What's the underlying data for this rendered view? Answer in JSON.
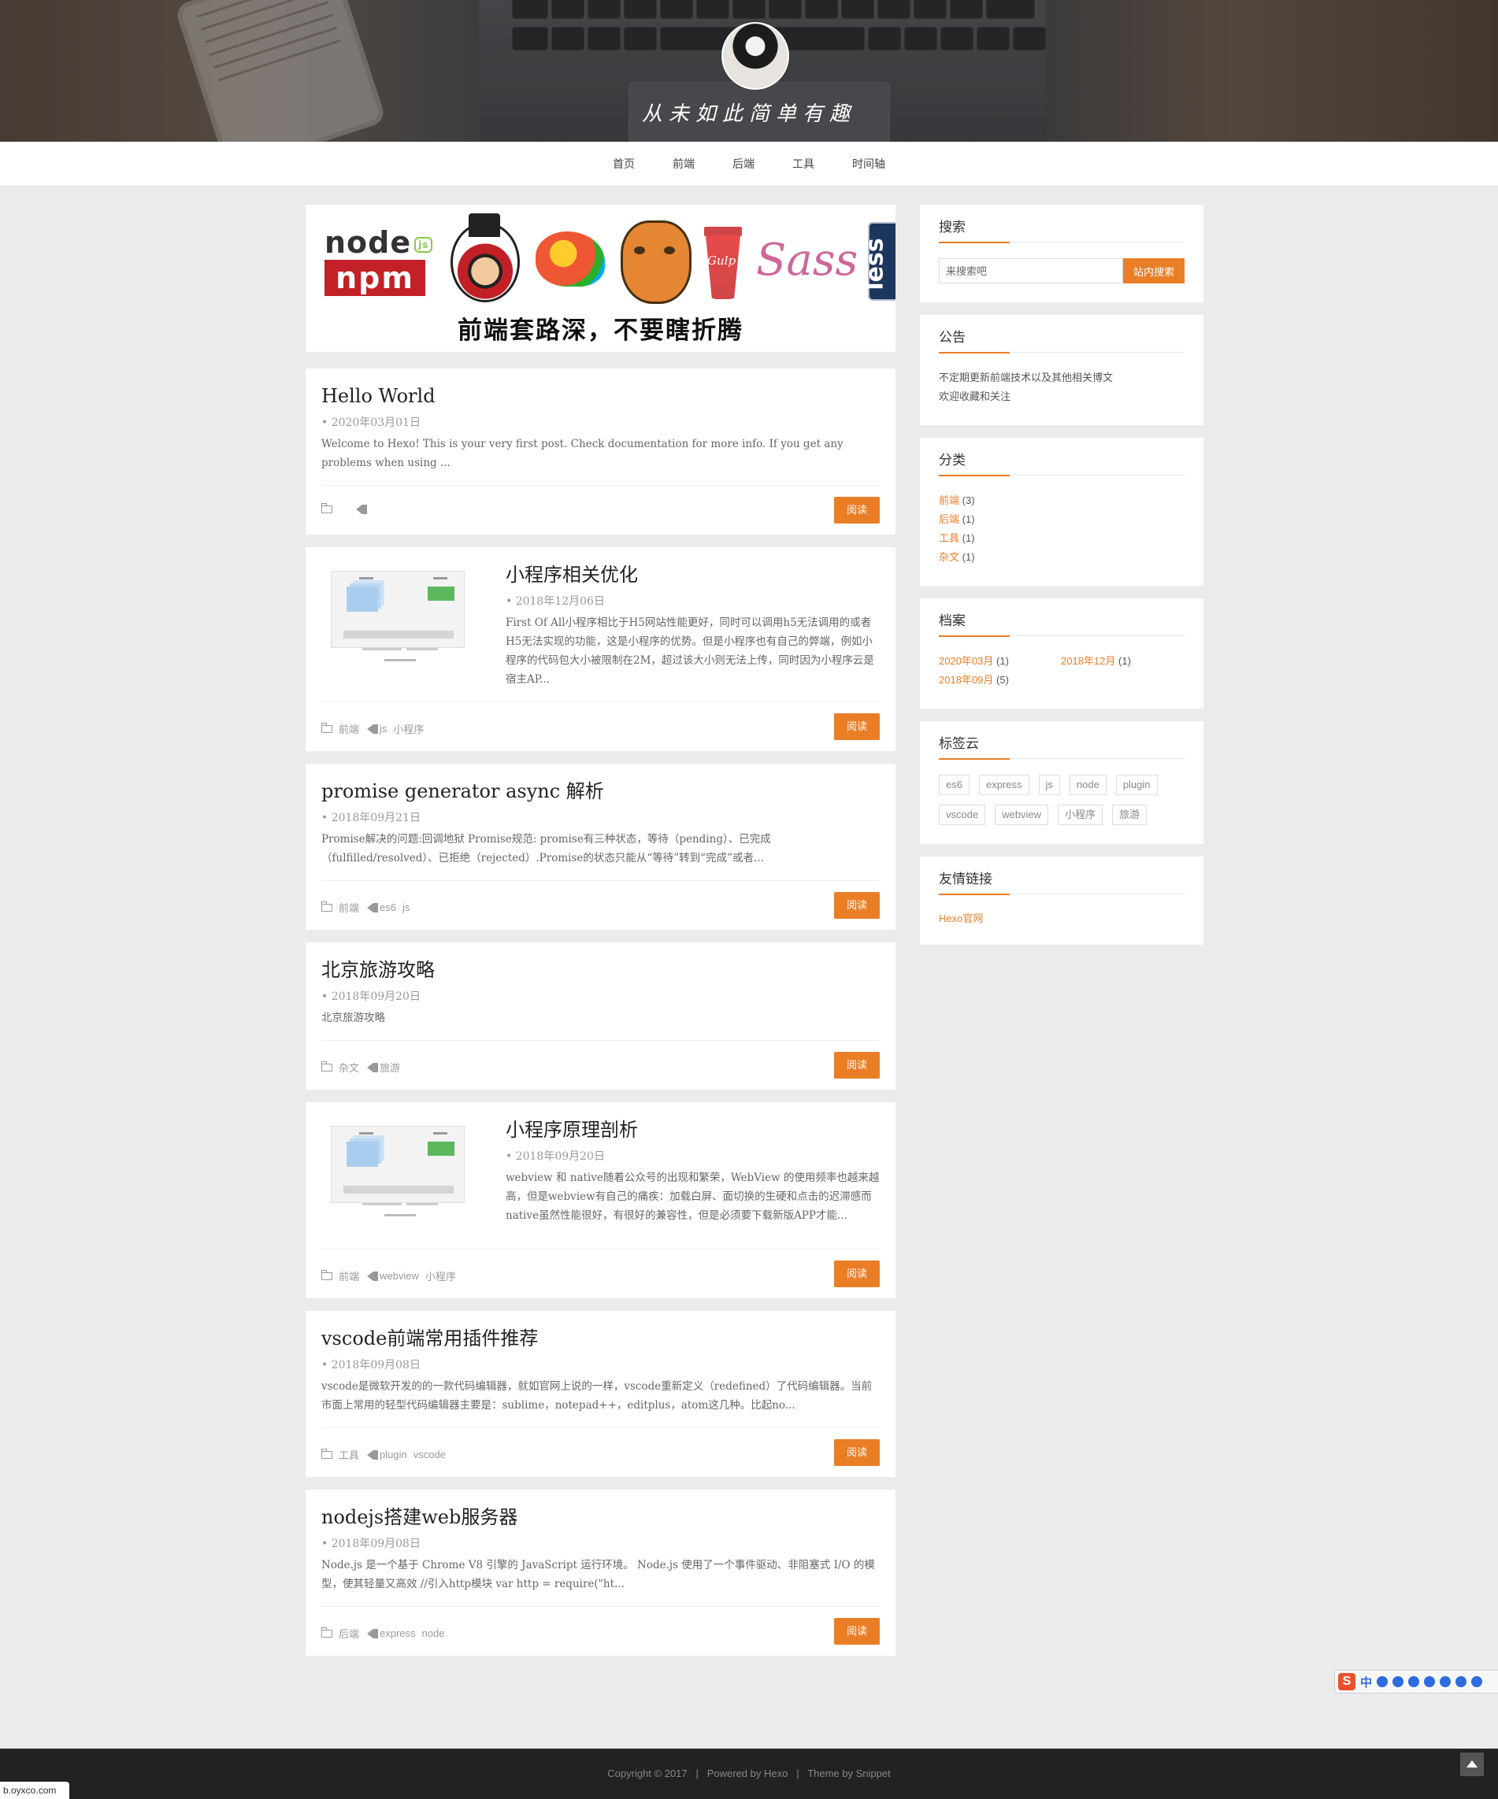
{
  "header": {
    "slogan": "从未如此简单有趣"
  },
  "nav": {
    "items": [
      "首页",
      "前端",
      "后端",
      "工具",
      "时间轴"
    ]
  },
  "banner": {
    "logo_texts": {
      "node": "node",
      "js": "js",
      "npm": "npm",
      "gulp": "Gulp",
      "sass": "Sass",
      "less": "less"
    },
    "caption": "前端套路深，不要瞎折腾"
  },
  "posts": [
    {
      "title": "Hello World",
      "date": "• 2020年03月01日",
      "excerpt": "Welcome to Hexo! This is your very first post. Check documentation for more info. If you get any problems when using ...",
      "category": "",
      "tags": [],
      "read_label": "阅读",
      "has_thumb": false
    },
    {
      "title": "小程序相关优化",
      "date": "• 2018年12月06日",
      "excerpt": "First Of All小程序相比于H5网站性能更好，同时可以调用h5无法调用的或者H5无法实现的功能，这是小程序的优势。但是小程序也有自己的弊端，例如小程序的代码包大小被限制在2M，超过该大小则无法上传，同时因为小程序云是宿主AP...",
      "category": "前端",
      "tags": [
        "js",
        "小程序"
      ],
      "read_label": "阅读",
      "has_thumb": true
    },
    {
      "title": "promise generator async 解析",
      "date": "• 2018年09月21日",
      "excerpt": "Promise解决的问题:回调地狱 Promise规范: promise有三种状态，等待（pending）、已完成（fulfilled/resolved）、已拒绝（rejected）.Promise的状态只能从“等待”转到“完成”或者...",
      "category": "前端",
      "tags": [
        "es6",
        "js"
      ],
      "read_label": "阅读",
      "has_thumb": false
    },
    {
      "title": "北京旅游攻略",
      "date": "• 2018年09月20日",
      "excerpt": "北京旅游攻略",
      "category": "杂文",
      "tags": [
        "旅游"
      ],
      "read_label": "阅读",
      "has_thumb": false
    },
    {
      "title": "小程序原理剖析",
      "date": "• 2018年09月20日",
      "excerpt": "webview 和 native随着公众号的出现和繁荣，WebView 的使用频率也越来越高，但是webview有自己的痛疾：加载白屏、面切换的生硬和点击的迟滞感而native虽然性能很好，有很好的兼容性，但是必须要下载新版APP才能...",
      "category": "前端",
      "tags": [
        "webview",
        "小程序"
      ],
      "read_label": "阅读",
      "has_thumb": true
    },
    {
      "title": "vscode前端常用插件推荐",
      "date": "• 2018年09月08日",
      "excerpt": "vscode是微软开发的的一款代码编辑器，就如官网上说的一样，vscode重新定义（redefined）了代码编辑器。当前市面上常用的轻型代码编辑器主要是：sublime，notepad++，editplus，atom这几种。比起no...",
      "category": "工具",
      "tags": [
        "plugin",
        "vscode"
      ],
      "read_label": "阅读",
      "has_thumb": false
    },
    {
      "title": "nodejs搭建web服务器",
      "date": "• 2018年09月08日",
      "excerpt": "Node.js 是一个基于 Chrome V8 引擎的 JavaScript 运行环境。 Node.js 使用了一个事件驱动、非阻塞式 I/O 的模型，使其轻量又高效 //引入http模块 var http = require(\"ht...",
      "category": "后端",
      "tags": [
        "express",
        "node"
      ],
      "read_label": "阅读",
      "has_thumb": false
    }
  ],
  "sidebar": {
    "search": {
      "title": "搜索",
      "placeholder": "来搜索吧",
      "button": "站内搜索"
    },
    "notice": {
      "title": "公告",
      "lines": [
        "不定期更新前端技术以及其他相关博文",
        "欢迎收藏和关注"
      ]
    },
    "categories": {
      "title": "分类",
      "items": [
        {
          "name": "前端",
          "count": "(3)"
        },
        {
          "name": "后端",
          "count": "(1)"
        },
        {
          "name": "工具",
          "count": "(1)"
        },
        {
          "name": "杂文",
          "count": "(1)"
        }
      ]
    },
    "archive": {
      "title": "档案",
      "items": [
        {
          "name": "2020年03月",
          "count": "(1)"
        },
        {
          "name": "2018年12月",
          "count": "(1)"
        },
        {
          "name": "2018年09月",
          "count": "(5)"
        }
      ]
    },
    "tagcloud": {
      "title": "标签云",
      "tags": [
        "es6",
        "express",
        "js",
        "node",
        "plugin",
        "vscode",
        "webview",
        "小程序",
        "旅游"
      ]
    },
    "links": {
      "title": "友情链接",
      "items": [
        "Hexo官网"
      ]
    }
  },
  "footer": {
    "copyright": "Copyright © 2017",
    "sep": "|",
    "powered": "Powered by Hexo",
    "theme": "Theme by Snippet"
  },
  "statusbar": {
    "url": "b.oyxco.com"
  },
  "ime": {
    "logo": "S",
    "mode": "中"
  },
  "colors": {
    "accent": "#ea7e26",
    "footer_bg": "#222222",
    "page_bg": "#ebebeb"
  }
}
